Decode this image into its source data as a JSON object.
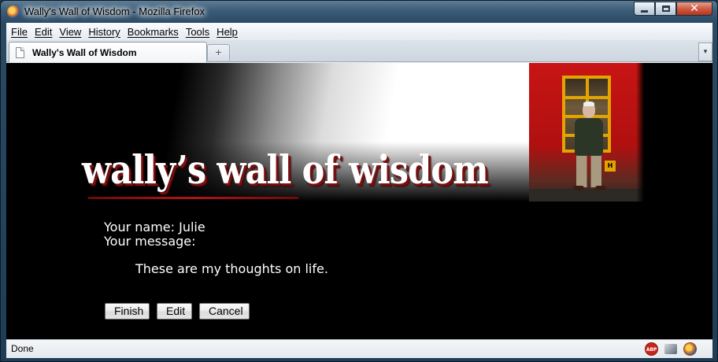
{
  "window": {
    "title": "Wally's Wall of Wisdom - Mozilla Firefox"
  },
  "menubar": {
    "items": [
      {
        "underlined": "F",
        "rest": "ile"
      },
      {
        "underlined": "E",
        "rest": "dit"
      },
      {
        "underlined": "V",
        "rest": "iew"
      },
      {
        "underlined": "Hi",
        "rest": "story"
      },
      {
        "underlined": "B",
        "rest": "ookmarks"
      },
      {
        "underlined": "T",
        "rest": "ools"
      },
      {
        "underlined": "H",
        "rest": "elp"
      }
    ]
  },
  "tabs": {
    "active_label": "Wally's Wall of Wisdom",
    "new_tab_glyph": "+",
    "list_glyph": "▾"
  },
  "page": {
    "site_title": "wally’s wall of wisdom",
    "name_line": "Your name: Julie",
    "message_label": "Your message:",
    "message_body": "These are my thoughts on life.",
    "buttons": {
      "finish": "Finish",
      "edit": "Edit",
      "cancel": "Cancel"
    },
    "photo_sign": "H"
  },
  "statusbar": {
    "text": "Done",
    "abp_label": "ABP"
  },
  "icons": {
    "titlebar": "firefox-icon",
    "tab": "page-icon",
    "status": [
      "adblock-plus-icon",
      "plugin-icon",
      "firefox-icon"
    ]
  },
  "colors": {
    "page_background": "#000000",
    "title_shadow": "#7a0f0f",
    "photo_wall": "#c81414",
    "window_frame": "#e1a400"
  }
}
